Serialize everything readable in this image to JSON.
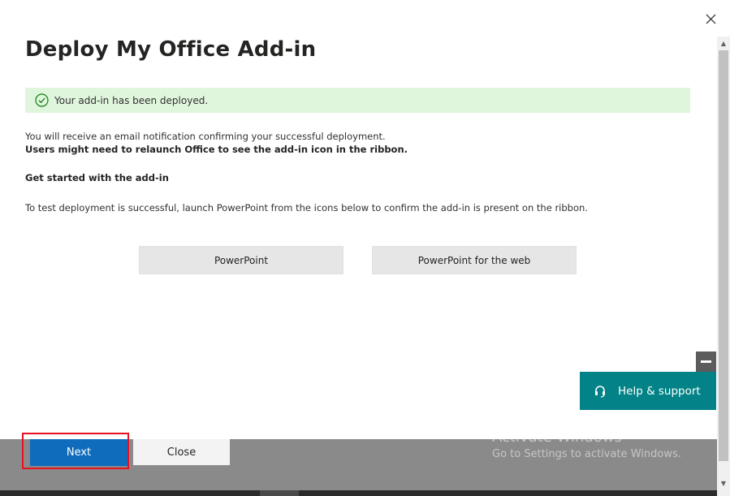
{
  "dialog": {
    "title": "Deploy My Office Add-in",
    "success_message": "Your add-in has been deployed.",
    "email_notice": "You will receive an email notification confirming your successful deployment.",
    "relaunch_notice": "Users might need to relaunch Office to see the add-in icon in the ribbon.",
    "get_started_heading": "Get started with the add-in",
    "test_instructions": "To test deployment is successful, launch PowerPoint from the icons below to confirm the add-in is present on the ribbon.",
    "launch_buttons": [
      "PowerPoint",
      "PowerPoint for the web"
    ]
  },
  "footer": {
    "next_label": "Next",
    "close_label": "Close"
  },
  "help": {
    "label": "Help & support"
  },
  "watermark": {
    "line1": "Activate Windows",
    "line2": "Go to Settings to activate Windows."
  },
  "colors": {
    "success_bg": "#dff6dd",
    "primary": "#0f6cbd",
    "help_teal": "#038387",
    "highlight": "#e81123"
  },
  "icons": {
    "close": "close-icon",
    "success": "check-circle-icon",
    "help": "headset-icon",
    "minimize": "minimize-icon"
  }
}
